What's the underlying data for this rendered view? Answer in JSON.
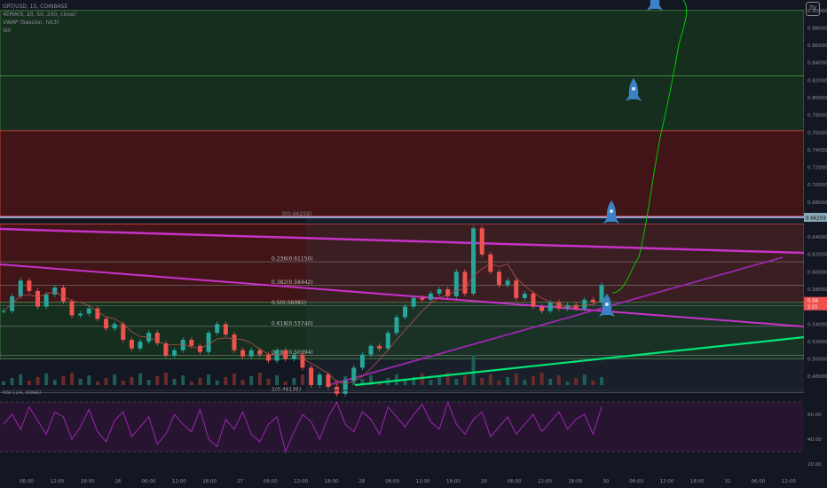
{
  "legend": {
    "symbol": "GRT/USD, 15, COINBASE",
    "ema": "4EMA(9, 20, 50, 200, close)",
    "vwap": "VWAP (Session, hlc3)",
    "vol": "Vol",
    "rsi": "RSI (14, close)"
  },
  "logo_text": "TV",
  "colors": {
    "background": "#131722",
    "up": "#26a69a",
    "down": "#ef5350",
    "magenta": "#c832c8",
    "purple": "#9c27b0",
    "green_trend": "#00e676",
    "fib_line": "#7d7d7d",
    "price_label": "#26a69a",
    "current_label": "#ef5350",
    "rsi_line": "#9c27b0",
    "drawing": "#00c800",
    "rocket": "#3b82c4"
  },
  "chart_data": [
    {
      "type": "line",
      "title": "",
      "series": [
        {
          "values": [
            0.555,
            0.572,
            0.59,
            0.578,
            0.56,
            0.574,
            0.582,
            0.566,
            0.55,
            0.552,
            0.558,
            0.546,
            0.535,
            0.54,
            0.522,
            0.512,
            0.52,
            0.53,
            0.518,
            0.504,
            0.51,
            0.522,
            0.515,
            0.508,
            0.53,
            0.54,
            0.528,
            0.51,
            0.503,
            0.51,
            0.505,
            0.498,
            0.51,
            0.5,
            0.505,
            0.49,
            0.47,
            0.482,
            0.468,
            0.46,
            0.475,
            0.49,
            0.505,
            0.515,
            0.512,
            0.53,
            0.548,
            0.56,
            0.57,
            0.568,
            0.575,
            0.58,
            0.572,
            0.6,
            0.575,
            0.65,
            0.62,
            0.6,
            0.585,
            0.59,
            0.57,
            0.575,
            0.56,
            0.555,
            0.565,
            0.558,
            0.562,
            0.558,
            0.568,
            0.565,
            0.585
          ]
        }
      ],
      "price_axis": [
        "0.90000",
        "0.88000",
        "0.86000",
        "0.84000",
        "0.82000",
        "0.80000",
        "0.78000",
        "0.76000",
        "0.74000",
        "0.72000",
        "0.70000",
        "0.68000",
        "0.66000",
        "0.64000",
        "0.62000",
        "0.60000",
        "0.58000",
        "0.56000",
        "0.54000",
        "0.52000",
        "0.50000",
        "0.48000"
      ],
      "ylim": [
        0.47,
        0.91
      ],
      "time_axis": [
        "06:00",
        "12:00",
        "18:00",
        "26",
        "06:00",
        "12:00",
        "18:00",
        "27",
        "06:00",
        "12:00",
        "18:00",
        "28",
        "06:00",
        "12:00",
        "18:00",
        "29",
        "06:00",
        "12:00",
        "18:00",
        "30",
        "06:00",
        "12:00",
        "18:00",
        "31",
        "06:00",
        "12:00"
      ],
      "fib_levels": [
        {
          "label": "0.236(0.61150)",
          "value": 0.6115
        },
        {
          "label": "0.382(0.58442)",
          "value": 0.58442
        },
        {
          "label": "0.5(0.56091)",
          "value": 0.56091
        },
        {
          "label": "0.618(0.53740)",
          "value": 0.5374
        },
        {
          "label": "0.786(0.50394)",
          "value": 0.50394
        },
        {
          "label": "1(0.46135)",
          "value": 0.46135
        }
      ],
      "fib_top_label": "0(0.66259)",
      "current_price_label": "0.66259",
      "last_price_label": "0.56",
      "last_price_sub": "2:15",
      "horizontal_zones": [
        {
          "top": 0.9,
          "bottom": 0.825,
          "fill": "green"
        },
        {
          "top": 0.825,
          "bottom": 0.762,
          "fill": "green"
        },
        {
          "top": 0.762,
          "bottom": 0.664,
          "fill": "red"
        },
        {
          "top": 0.655,
          "bottom": 0.565,
          "fill": "red"
        },
        {
          "top": 0.565,
          "bottom": 0.5,
          "fill": "green"
        }
      ]
    },
    {
      "type": "line",
      "title": "",
      "series": [
        {
          "values": [
            52,
            60,
            48,
            66,
            55,
            44,
            62,
            58,
            40,
            50,
            64,
            46,
            38,
            55,
            62,
            42,
            50,
            58,
            36,
            44,
            60,
            52,
            46,
            64,
            40,
            34,
            56,
            48,
            62,
            44,
            38,
            52,
            58,
            30,
            46,
            60,
            54,
            40,
            58,
            70,
            52,
            46,
            62,
            56,
            44,
            66,
            58,
            50,
            60,
            68,
            54,
            48,
            70,
            52,
            44,
            56,
            62,
            42,
            50,
            58,
            44,
            52,
            60,
            46,
            54,
            62,
            48,
            56,
            60,
            44,
            66
          ]
        }
      ],
      "price_axis": [
        "60.00",
        "40.00",
        "20.00"
      ],
      "ylim": [
        15,
        75
      ]
    }
  ]
}
